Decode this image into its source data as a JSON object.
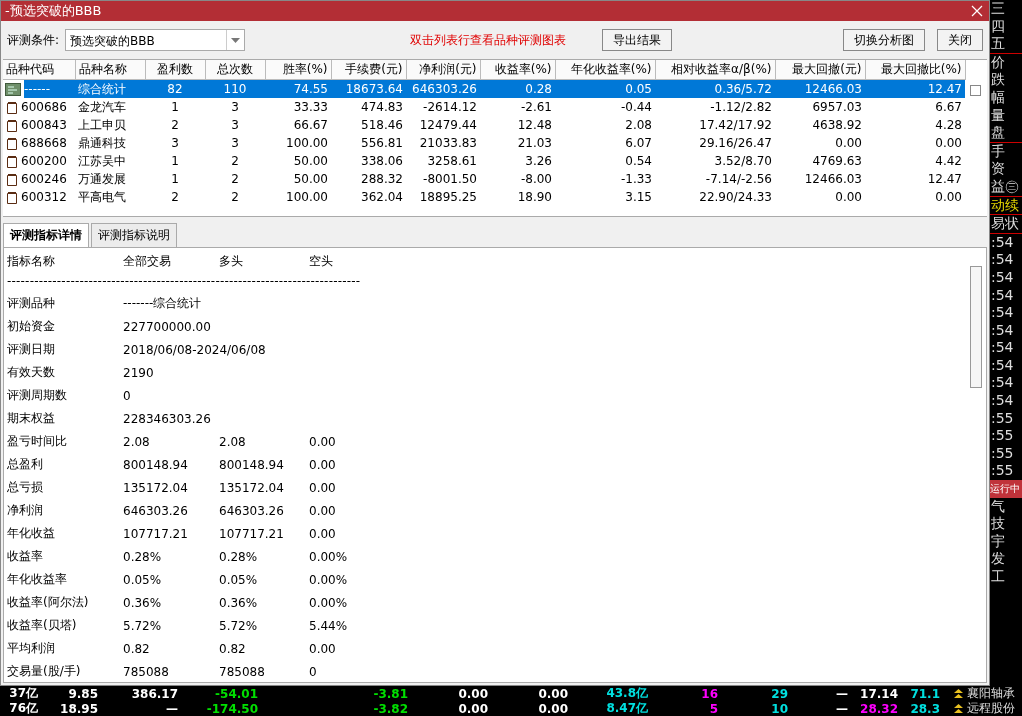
{
  "window": {
    "title": "-预选突破的BBB"
  },
  "filter": {
    "label": "评测条件:",
    "value": "预选突破的BBB"
  },
  "hint": "双击列表行查看品种评测图表",
  "buttons": [
    {
      "label": "导出结果",
      "kind": "left"
    },
    {
      "label": "切换分析图",
      "kind": "right"
    },
    {
      "label": "关闭",
      "kind": "right"
    }
  ],
  "table": {
    "columns": [
      "品种代码",
      "品种名称",
      "盈利数",
      "总次数",
      "胜率(%)",
      "手续费(元)",
      "净利润(元)",
      "收益率(%)",
      "年化收益率(%)",
      "相对收益率α/β(%)",
      "最大回撤(元)",
      "最大回撤比(%)"
    ],
    "rows": [
      {
        "kind": "summary",
        "selected": true,
        "cells": [
          "------",
          "综合统计",
          "82",
          "110",
          "74.55",
          "18673.64",
          "646303.26",
          "0.28",
          "0.05",
          "0.36/5.72",
          "12466.03",
          "12.47"
        ]
      },
      {
        "kind": "stock",
        "selected": false,
        "cells": [
          "600686",
          "金龙汽车",
          "1",
          "3",
          "33.33",
          "474.83",
          "-2614.12",
          "-2.61",
          "-0.44",
          "-1.12/2.82",
          "6957.03",
          "6.67"
        ]
      },
      {
        "kind": "stock",
        "selected": false,
        "cells": [
          "600843",
          "上工申贝",
          "2",
          "3",
          "66.67",
          "518.46",
          "12479.44",
          "12.48",
          "2.08",
          "17.42/17.92",
          "4638.92",
          "4.28"
        ]
      },
      {
        "kind": "stock",
        "selected": false,
        "cells": [
          "688668",
          "鼎通科技",
          "3",
          "3",
          "100.00",
          "556.81",
          "21033.83",
          "21.03",
          "6.07",
          "29.16/26.47",
          "0.00",
          "0.00"
        ]
      },
      {
        "kind": "stock",
        "selected": false,
        "cells": [
          "600200",
          "江苏吴中",
          "1",
          "2",
          "50.00",
          "338.06",
          "3258.61",
          "3.26",
          "0.54",
          "3.52/8.70",
          "4769.63",
          "4.42"
        ]
      },
      {
        "kind": "stock",
        "selected": false,
        "cells": [
          "600246",
          "万通发展",
          "1",
          "2",
          "50.00",
          "288.32",
          "-8001.50",
          "-8.00",
          "-1.33",
          "-7.14/-2.56",
          "12466.03",
          "12.47"
        ]
      },
      {
        "kind": "stock",
        "selected": false,
        "cells": [
          "600312",
          "平高电气",
          "2",
          "2",
          "100.00",
          "362.04",
          "18895.25",
          "18.90",
          "3.15",
          "22.90/24.33",
          "0.00",
          "0.00"
        ]
      }
    ]
  },
  "tabs": [
    {
      "label": "评测指标详情",
      "selected": true
    },
    {
      "label": "评测指标说明",
      "selected": false
    }
  ],
  "details": {
    "header": [
      "指标名称",
      "全部交易",
      "多头",
      "空头"
    ],
    "divider": "------------------------------------------------------------------------------",
    "rows": [
      [
        "评测品种",
        "-------综合统计"
      ],
      [
        "初始资金",
        "227700000.00"
      ],
      [
        "评测日期",
        "2018/06/08-2024/06/08"
      ],
      [
        "有效天数",
        "2190"
      ],
      [
        "评测周期数",
        "0"
      ],
      [
        "期末权益",
        "228346303.26"
      ],
      [
        "盈亏时间比",
        "2.08",
        "2.08",
        "0.00"
      ],
      [
        "总盈利",
        "800148.94",
        "800148.94",
        "0.00"
      ],
      [
        "总亏损",
        "135172.04",
        "135172.04",
        "0.00"
      ],
      [
        "净利润",
        "646303.26",
        "646303.26",
        "0.00"
      ],
      [
        "年化收益",
        "107717.21",
        "107717.21",
        "0.00"
      ],
      [
        "收益率",
        "0.28%",
        "0.28%",
        "0.00%"
      ],
      [
        "年化收益率",
        "0.05%",
        "0.05%",
        "0.00%"
      ],
      [
        "收益率(阿尔法)",
        "0.36%",
        "0.36%",
        "0.00%"
      ],
      [
        "收益率(贝塔)",
        "5.72%",
        "5.72%",
        "5.44%"
      ],
      [
        "平均利润",
        "0.82",
        "0.82",
        "0.00"
      ],
      [
        "交易量(股/手)",
        "785088",
        "785088",
        "0"
      ]
    ]
  },
  "side_strip": [
    {
      "text": "三",
      "kind": "plain"
    },
    {
      "text": "四",
      "kind": "plain"
    },
    {
      "text": "五",
      "kind": "plain"
    },
    {
      "kind": "rule"
    },
    {
      "text": "价",
      "kind": "plain"
    },
    {
      "text": "跌",
      "kind": "plain"
    },
    {
      "text": "幅",
      "kind": "plain"
    },
    {
      "text": "量",
      "kind": "plain"
    },
    {
      "text": "盘",
      "kind": "plain"
    },
    {
      "kind": "rule"
    },
    {
      "text": "手",
      "kind": "plain"
    },
    {
      "text": "资",
      "kind": "plain"
    },
    {
      "text": "益㊂",
      "kind": "plain"
    },
    {
      "kind": "rule"
    },
    {
      "text": "动续",
      "kind": "highlight"
    },
    {
      "kind": "rule"
    },
    {
      "text": "易状",
      "kind": "plain"
    },
    {
      "kind": "rule"
    },
    {
      "text": ":54",
      "kind": "plain"
    },
    {
      "text": ":54",
      "kind": "plain"
    },
    {
      "text": ":54",
      "kind": "plain"
    },
    {
      "text": ":54",
      "kind": "plain"
    },
    {
      "text": ":54",
      "kind": "plain"
    },
    {
      "text": ":54",
      "kind": "plain"
    },
    {
      "text": ":54",
      "kind": "plain"
    },
    {
      "text": ":54",
      "kind": "plain"
    },
    {
      "text": ":54",
      "kind": "plain"
    },
    {
      "text": ":54",
      "kind": "plain"
    },
    {
      "text": ":55",
      "kind": "plain"
    },
    {
      "text": ":55",
      "kind": "plain"
    },
    {
      "text": ":55",
      "kind": "plain"
    },
    {
      "text": ":55",
      "kind": "plain"
    },
    {
      "text": "运行中",
      "kind": "status"
    },
    {
      "text": "气",
      "kind": "plain"
    },
    {
      "text": "技",
      "kind": "plain"
    },
    {
      "text": "宇",
      "kind": "plain"
    },
    {
      "text": "发",
      "kind": "plain"
    },
    {
      "text": "工",
      "kind": "plain"
    }
  ],
  "quote_rows": [
    {
      "name": "襄阳轴承",
      "cells": [
        {
          "text": "37亿"
        },
        {
          "text": "9.85"
        },
        {
          "text": "386.17"
        },
        {
          "text": "-54.01",
          "color": "#00e000"
        },
        {
          "text": "-3.81",
          "color": "#00e000"
        },
        {
          "text": "0.00"
        },
        {
          "text": "0.00"
        },
        {
          "text": "43.8亿",
          "color": "#00e0e0"
        },
        {
          "text": "16",
          "color": "#ff00ff"
        },
        {
          "text": "29",
          "color": "#00e0e0"
        },
        {
          "text": "—"
        },
        {
          "text": "17.14"
        },
        {
          "text": "71.1",
          "color": "#00e0e0"
        }
      ]
    },
    {
      "name": "远程股份",
      "cells": [
        {
          "text": "76亿"
        },
        {
          "text": "18.95"
        },
        {
          "text": "—"
        },
        {
          "text": "-174.50",
          "color": "#00e000"
        },
        {
          "text": "-3.82",
          "color": "#00e000"
        },
        {
          "text": "0.00"
        },
        {
          "text": "0.00"
        },
        {
          "text": "8.47亿",
          "color": "#00e0e0"
        },
        {
          "text": "5",
          "color": "#ff00ff"
        },
        {
          "text": "10",
          "color": "#00e0e0"
        },
        {
          "text": "—"
        },
        {
          "text": "28.32",
          "color": "#ff00ff"
        },
        {
          "text": "28.3",
          "color": "#00e0e0"
        }
      ]
    }
  ]
}
